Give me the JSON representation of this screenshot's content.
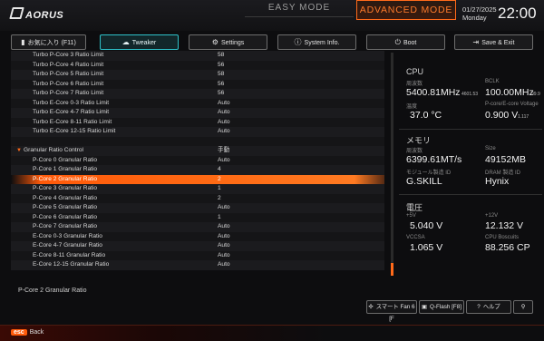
{
  "brand": {
    "name": "AORUS"
  },
  "modes": {
    "easy": "EASY MODE",
    "advanced": "ADVANCED MODE"
  },
  "clock": {
    "date": "01/27/2025",
    "day": "Monday",
    "time": "22:00"
  },
  "tabs": [
    {
      "icon": "bookmark-icon",
      "label": "お気に入り (F11)"
    },
    {
      "icon": "cloud-icon",
      "label": "Tweaker"
    },
    {
      "icon": "gear-icon",
      "label": "Settings"
    },
    {
      "icon": "info-icon",
      "label": "System Info."
    },
    {
      "icon": "power-icon",
      "label": "Boot"
    },
    {
      "icon": "exit-icon",
      "label": "Save & Exit"
    }
  ],
  "list": {
    "rows": [
      {
        "label": "Turbo P-Core 3  Ratio Limit",
        "value": "58"
      },
      {
        "label": "Turbo P-Core 4  Ratio Limit",
        "value": "56"
      },
      {
        "label": "Turbo P-Core 5  Ratio Limit",
        "value": "58"
      },
      {
        "label": "Turbo P-Core 6  Ratio Limit",
        "value": "56"
      },
      {
        "label": "Turbo P-Core 7  Ratio Limit",
        "value": "56"
      },
      {
        "label": "Turbo E-Core 0-3   Ratio Limit",
        "value": "Auto"
      },
      {
        "label": "Turbo E-Core 4-7   Ratio Limit",
        "value": "Auto"
      },
      {
        "label": "Turbo E-Core 8-11  Ratio Limit",
        "value": "Auto"
      },
      {
        "label": "Turbo E-Core 12-15 Ratio Limit",
        "value": "Auto"
      },
      {
        "label": "",
        "value": ""
      },
      {
        "label": "Granular Ratio Control",
        "value": "手動",
        "section": true
      },
      {
        "label": "P-Core 0 Granular Ratio",
        "value": "Auto"
      },
      {
        "label": "P-Core 1 Granular Ratio",
        "value": "4"
      },
      {
        "label": "P-Core 2 Granular Ratio",
        "value": "2",
        "selected": true
      },
      {
        "label": "P-Core 3 Granular Ratio",
        "value": "1"
      },
      {
        "label": "P-Core 4 Granular Ratio",
        "value": "2"
      },
      {
        "label": "P-Core 5 Granular Ratio",
        "value": "Auto"
      },
      {
        "label": "P-Core 6 Granular Ratio",
        "value": "1"
      },
      {
        "label": "P-Core 7 Granular Ratio",
        "value": "Auto"
      },
      {
        "label": "E-Core 0-3   Granular Ratio",
        "value": "Auto"
      },
      {
        "label": "E-Core 4-7   Granular Ratio",
        "value": "Auto"
      },
      {
        "label": "E-Core 8-11  Granular Ratio",
        "value": "Auto"
      },
      {
        "label": "E-Core 12-15 Granular Ratio",
        "value": "Auto"
      }
    ]
  },
  "info": {
    "cpu": {
      "title": "CPU",
      "freq_label": "周波数",
      "freq_value": "5400.81MHz",
      "freq_sub": "4601.53",
      "bclk_label": "BCLK",
      "bclk_value": "100.00MHz",
      "bclk_sub": "99.9",
      "temp_label": "温度",
      "temp_value": "37.0 °C",
      "volt_label": "P-core/E-core Voltage",
      "volt_value": "0.900 V",
      "volt_sub": "1.117"
    },
    "memory": {
      "title": "メモリ",
      "freq_label": "周波数",
      "freq_value": "6399.61MT/s",
      "size_label": "Size",
      "size_value": "49152MB",
      "vendor_label": "モジュール製造 ID",
      "vendor_value": "G.SKILL",
      "dram_label": "DRAM 製造 ID",
      "dram_value": "Hynix"
    },
    "voltage": {
      "title": "電圧",
      "v5_label": "+5V",
      "v5_value": "5.040 V",
      "v12_label": "+12V",
      "v12_value": "12.132 V",
      "vccsa_label": "VCCSA",
      "vccsa_value": "1.065 V",
      "fan_label": "CPU Boscuits",
      "fan_value": "88.256 CP"
    }
  },
  "help_text": "P-Core 2 Granular Ratio",
  "buttons": {
    "smart_fan": "スマート Fan 6 [F",
    "qflash": "Q-Flash [F8]",
    "help": "ヘルプ",
    "search_icon": "search-icon"
  },
  "footer": {
    "esc": "esc",
    "back": "Back"
  },
  "colors": {
    "accent": "#ff6a1a",
    "tab_active": "#2ec2c9",
    "background": "#0d0d0f"
  }
}
